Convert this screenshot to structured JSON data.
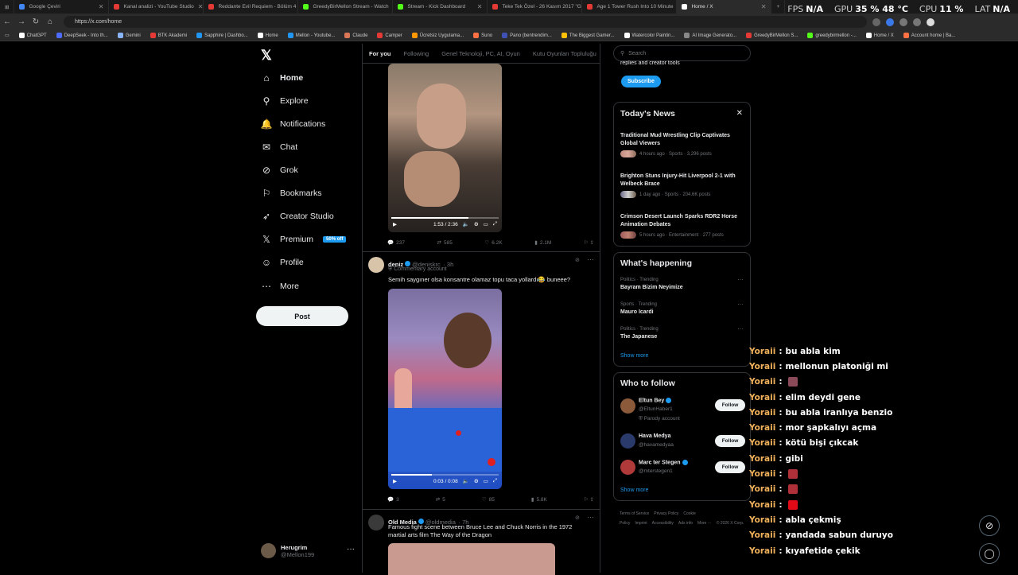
{
  "browser": {
    "tabs": [
      {
        "title": "Google Çeviri",
        "color": "#4285f4",
        "active": false
      },
      {
        "title": "Kanal analizi - YouTube Studio",
        "color": "#e53935",
        "active": false
      },
      {
        "title": "Reddante Evil Requiem - Bölüm 4",
        "color": "#e53935",
        "active": false
      },
      {
        "title": "GreedyBirMellon Stream - Watch",
        "color": "#53fc18",
        "active": false
      },
      {
        "title": "Stream - Kick Dashboard",
        "color": "#53fc18",
        "active": false
      },
      {
        "title": "Teke Tek Özel - 26 Kasım 2017 \"Gi",
        "color": "#e53935",
        "active": false
      },
      {
        "title": "Age 1 Tower Rush Into 10 Minute",
        "color": "#e53935",
        "active": false
      },
      {
        "title": "Home / X",
        "color": "#ffffff",
        "active": true
      }
    ],
    "new_tab": "+",
    "url": "https://x.com/home",
    "stats": {
      "fps_label": "FPS",
      "fps": "N/A",
      "gpu_label": "GPU",
      "gpu": "35 %  48 °C",
      "cpu_label": "CPU",
      "cpu": "11 %",
      "lat_label": "LAT",
      "lat": "N/A"
    },
    "bookmarks": [
      {
        "label": "ChatGPT",
        "color": "#fff"
      },
      {
        "label": "DeepSeek - Into th...",
        "color": "#4d6bfe"
      },
      {
        "label": "Gemini",
        "color": "#8ab4f8"
      },
      {
        "label": "BTK Akademi",
        "color": "#e53935"
      },
      {
        "label": "Sapphire | Dashbo...",
        "color": "#2196f3"
      },
      {
        "label": "Home",
        "color": "#fff"
      },
      {
        "label": "Mellon - Youtube...",
        "color": "#2196f3"
      },
      {
        "label": "Claude",
        "color": "#d97757"
      },
      {
        "label": "Camper",
        "color": "#e53935"
      },
      {
        "label": "Ücretsiz Uygulama...",
        "color": "#ff9800"
      },
      {
        "label": "Suno",
        "color": "#ff7043"
      },
      {
        "label": "Pano (bentrendim...",
        "color": "#3f51b5"
      },
      {
        "label": "The Biggest Gamer...",
        "color": "#ffc107"
      },
      {
        "label": "Watercolor Paintin...",
        "color": "#fff"
      },
      {
        "label": "AI Image Generato...",
        "color": "#888"
      },
      {
        "label": "GreedyBirMellon S...",
        "color": "#e53935"
      },
      {
        "label": "greedybirmellon -...",
        "color": "#53fc18"
      },
      {
        "label": "Home / X",
        "color": "#fff"
      },
      {
        "label": "Account home | Ba...",
        "color": "#ff7043"
      }
    ]
  },
  "nav": {
    "logo": "𝕏",
    "items": [
      {
        "label": "Home",
        "icon": "home-icon",
        "glyph": "⌂"
      },
      {
        "label": "Explore",
        "icon": "search-icon",
        "glyph": "⚲"
      },
      {
        "label": "Notifications",
        "icon": "bell-icon",
        "glyph": "🔔"
      },
      {
        "label": "Chat",
        "icon": "mail-icon",
        "glyph": "✉"
      },
      {
        "label": "Grok",
        "icon": "grok-icon",
        "glyph": "⊘"
      },
      {
        "label": "Bookmarks",
        "icon": "bookmark-icon",
        "glyph": "⚐"
      },
      {
        "label": "Creator Studio",
        "icon": "rocket-icon",
        "glyph": "➶"
      },
      {
        "label": "Premium",
        "icon": "x-premium-icon",
        "glyph": "𝕏"
      },
      {
        "label": "Profile",
        "icon": "person-icon",
        "glyph": "☺"
      },
      {
        "label": "More",
        "icon": "more-circle-icon",
        "glyph": "⋯"
      }
    ],
    "premium_badge": "50% off",
    "post_button": "Post",
    "account": {
      "name": "Herugrim",
      "handle": "@Mellon199",
      "more": "···"
    }
  },
  "feed": {
    "tabs": [
      "For you",
      "Following",
      "Genel Teknoloji, PC, AI, Oyun",
      "Kutu Oyunları Topluluğu"
    ],
    "post1": {
      "video_time": "1:53 / 2:36",
      "progress": 0.72,
      "stats": {
        "replies": "237",
        "reposts": "585",
        "likes": "6.2K",
        "views": "2.1M"
      }
    },
    "post2": {
      "name": "deniz",
      "handle": "@deniskrc",
      "time": "· 3h",
      "label": "Commentary account",
      "text": "Semih saygıner olsa konsantre olamaz topu taca yollardı😂 buneee?",
      "video_time": "0:03 / 0:08",
      "progress": 0.38,
      "stats": {
        "replies": "3",
        "reposts": "5",
        "likes": "85",
        "views": "5.8K"
      }
    },
    "post3": {
      "name": "Old Media",
      "handle": "@oldmedia",
      "time": "· 7h",
      "text": "Famous fight scene between Bruce Lee and Chuck Norris in the 1972 martial arts film The Way of the Dragon"
    }
  },
  "right": {
    "search_placeholder": "Search",
    "premium_snippet": "replies and creator tools",
    "subscribe": "Subscribe",
    "news": {
      "title": "Today's News",
      "items": [
        {
          "title": "Traditional Mud Wrestling Clip Captivates Global Viewers",
          "meta": "4 hours ago · Sports · 3,296 posts"
        },
        {
          "title": "Brighton Stuns Injury-Hit Liverpool 2-1 with Welbeck Brace",
          "meta": "1 day ago · Sports · 204.6K posts"
        },
        {
          "title": "Crimson Desert Launch Sparks RDR2 Horse Animation Debates",
          "meta": "5 hours ago · Entertainment · 277 posts"
        }
      ]
    },
    "happening": {
      "title": "What's happening",
      "items": [
        {
          "meta": "Politics · Trending",
          "name": "Bayram Bizim Neyimize"
        },
        {
          "meta": "Sports · Trending",
          "name": "Mauro Icardi"
        },
        {
          "meta": "Politics · Trending",
          "name": "The Japanese"
        }
      ],
      "show_more": "Show more"
    },
    "follow": {
      "title": "Who to follow",
      "items": [
        {
          "name": "Eltun Bey",
          "handle": "@EltunHaber1",
          "extra": "Parody account",
          "button": "Follow"
        },
        {
          "name": "Hava Medya",
          "handle": "@havamedyaa",
          "extra": "",
          "button": "Follow"
        },
        {
          "name": "Marc ter Stegen",
          "handle": "@mterstegen1",
          "extra": "",
          "button": "Follow"
        }
      ],
      "show_more": "Show more"
    },
    "footer": [
      "Terms of Service",
      "Privacy Policy",
      "Cookie Policy",
      "Imprint",
      "Accessibility",
      "Ads info",
      "More ···",
      "© 2026 X Corp."
    ]
  },
  "chat": {
    "messages": [
      {
        "user": "Yoraii",
        "text": "bu abla kim",
        "emote": ""
      },
      {
        "user": "Yoraii",
        "text": "mellonun platoniği mi",
        "emote": ""
      },
      {
        "user": "Yoraii",
        "text": "",
        "emote": "#8a4a5a"
      },
      {
        "user": "Yoraii",
        "text": "elim deydi gene",
        "emote": ""
      },
      {
        "user": "Yoraii",
        "text": "bu abla iranlıya benzio",
        "emote": ""
      },
      {
        "user": "Yoraii",
        "text": "mor şapkalıyı açma",
        "emote": ""
      },
      {
        "user": "Yoraii",
        "text": "kötü bişi çıkcak",
        "emote": ""
      },
      {
        "user": "Yoraii",
        "text": "gibi",
        "emote": ""
      },
      {
        "user": "Yoraii",
        "text": "",
        "emote": "#b0303a"
      },
      {
        "user": "Yoraii",
        "text": "",
        "emote": "#b0303a"
      },
      {
        "user": "Yoraii",
        "text": "",
        "emote": "#e30a17"
      },
      {
        "user": "Yoraii",
        "text": "abla çekmiş",
        "emote": ""
      },
      {
        "user": "Yoraii",
        "text": "yandada sabun duruyo",
        "emote": ""
      },
      {
        "user": "Yoraii",
        "text": "kıyafetide çekik",
        "emote": ""
      }
    ]
  },
  "colors": {
    "accent": "#1d9bf0",
    "chat_user": "#f0b15a",
    "background": "#000000"
  }
}
